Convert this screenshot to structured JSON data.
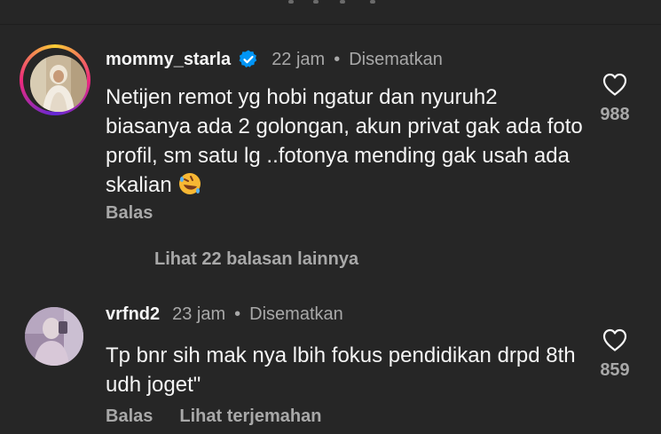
{
  "comments": [
    {
      "username": "mommy_starla",
      "verified": true,
      "time": "22 jam",
      "separator": "•",
      "pinned": "Disematkan",
      "text": "Netijen remot yg hobi ngatur dan nyuruh2 biasanya ada 2 golongan, akun privat gak ada foto profil, sm satu lg ..fotonya mending gak usah ada skalian",
      "emoji": "rolling-on-floor-laughing-emoji",
      "reply_label": "Balas",
      "likes": "988"
    },
    {
      "username": "vrfnd2",
      "verified": false,
      "time": "23 jam",
      "separator": "•",
      "pinned": "Disematkan",
      "text": "Tp bnr sih mak nya lbih fokus pendidikan drpd 8th udh joget\"",
      "reply_label": "Balas",
      "translate_label": "Lihat terjemahan",
      "likes": "859"
    }
  ],
  "view_replies": "Lihat 22 balasan lainnya",
  "colors": {
    "background": "#262626",
    "primary_text": "#f5f5f5",
    "secondary_text": "#a8a8a8",
    "verified_blue": "#0095f6"
  }
}
